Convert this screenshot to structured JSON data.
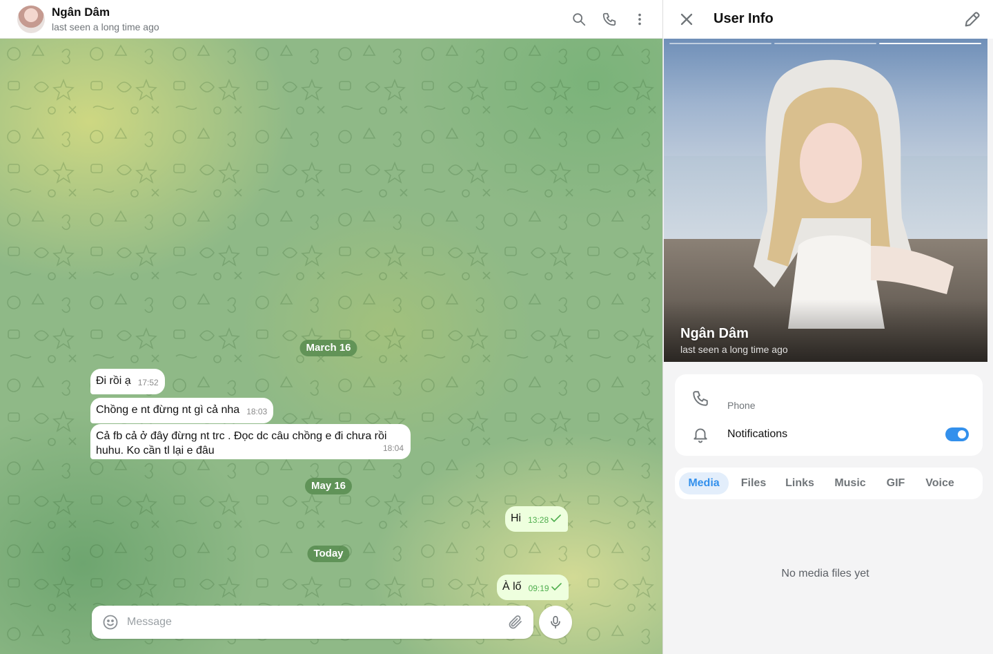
{
  "chat": {
    "title": "Ngân Dâm",
    "status": "last seen a long time ago",
    "dates": [
      "March 16",
      "May 16",
      "Today"
    ],
    "messages": [
      {
        "dir": "in",
        "text": "Đi rồi ạ",
        "time": "17:52"
      },
      {
        "dir": "in",
        "text": "Chồng e nt đừng nt gì cả nha",
        "time": "18:03"
      },
      {
        "dir": "in",
        "text": "Cả fb cả ở đây đừng nt trc . Đọc dc câu chồng e đi chưa rồi huhu. Ko cần tl lại e đâu",
        "time": "18:04"
      },
      {
        "dir": "out",
        "text": "Hi",
        "time": "13:28"
      },
      {
        "dir": "out",
        "text": "À lố",
        "time": "09:19"
      }
    ],
    "composer": {
      "placeholder": "Message"
    }
  },
  "panel": {
    "title": "User Info",
    "name": "Ngân Dâm",
    "status": "last seen a long time ago",
    "phone_label": "Phone",
    "notifications_label": "Notifications",
    "notifications_enabled": true,
    "tabs": [
      {
        "label": "Media",
        "active": true
      },
      {
        "label": "Files",
        "active": false
      },
      {
        "label": "Links",
        "active": false
      },
      {
        "label": "Music",
        "active": false
      },
      {
        "label": "GIF",
        "active": false
      },
      {
        "label": "Voice",
        "active": false
      }
    ],
    "empty_text": "No media files yet"
  },
  "colors": {
    "accent": "#3390ec",
    "outgoing_bubble": "#eeffde",
    "date_pill": "#588c50"
  },
  "icons": [
    "search-icon",
    "phone-icon",
    "more-vertical-icon",
    "close-icon",
    "pencil-icon",
    "bell-icon",
    "smile-icon",
    "paperclip-icon",
    "microphone-icon",
    "double-check-icon"
  ]
}
